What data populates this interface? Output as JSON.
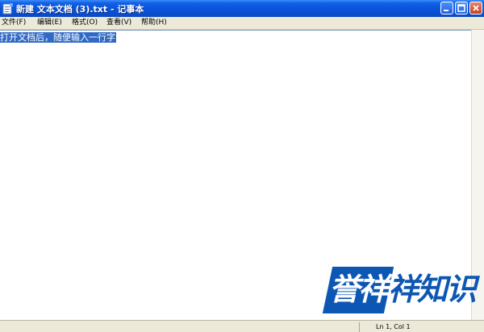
{
  "window": {
    "title": "新建 文本文档 (3).txt - 记事本",
    "controls": {
      "minimize": "minimize",
      "maximize": "maximize",
      "close": "close"
    }
  },
  "menu": [
    {
      "label": "文件(F)"
    },
    {
      "label": "编辑(E)"
    },
    {
      "label": "格式(O)"
    },
    {
      "label": "查看(V)"
    },
    {
      "label": "帮助(H)"
    }
  ],
  "editor": {
    "selected_text": "打开文档后，随便输入一行字"
  },
  "status": {
    "position": "Ln 1, Col 1"
  },
  "watermark": {
    "part1": "誉祥",
    "part2": "祥知识"
  },
  "colors": {
    "titlebar": "#0a55db",
    "selection": "#316ac5",
    "watermark": "#0d57b4"
  },
  "icons": {
    "app": "notepad-icon",
    "minimize": "minimize-icon",
    "maximize": "maximize-icon",
    "close": "close-icon"
  }
}
